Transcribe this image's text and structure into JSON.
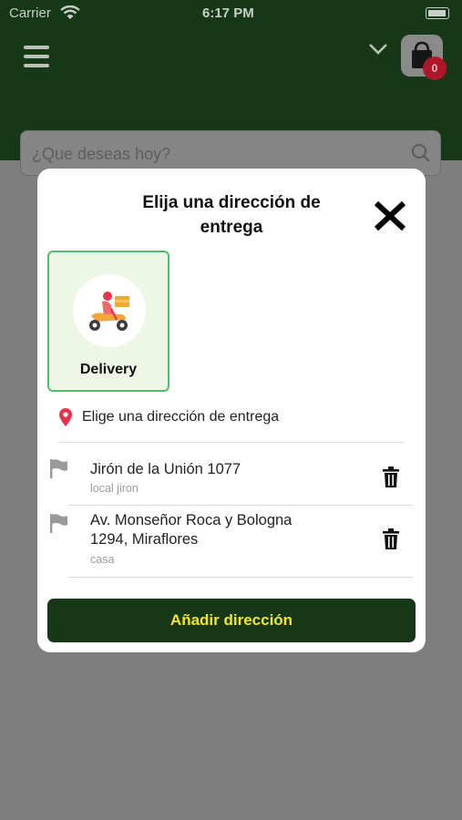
{
  "status_bar": {
    "carrier": "Carrier",
    "time": "6:17 PM"
  },
  "header": {
    "cart_count": "0",
    "search_placeholder": "¿Que deseas hoy?"
  },
  "modal": {
    "title": "Elija una dirección de entrega",
    "option_label": "Delivery",
    "address_header": "Elige una dirección de entrega",
    "addresses": [
      {
        "line": "Jirón de la Unión 1077",
        "note": "local jiron"
      },
      {
        "line": "Av. Monseñor Roca y Bologna 1294, Miraflores",
        "note": "casa"
      }
    ],
    "add_button_label": "Añadir dirección"
  },
  "colors": {
    "header_green": "#163816",
    "accent_yellow": "#f2e52a",
    "card_border_green": "#4fbf6f",
    "badge_red": "#b0162a",
    "pin_red": "#e8344a"
  }
}
